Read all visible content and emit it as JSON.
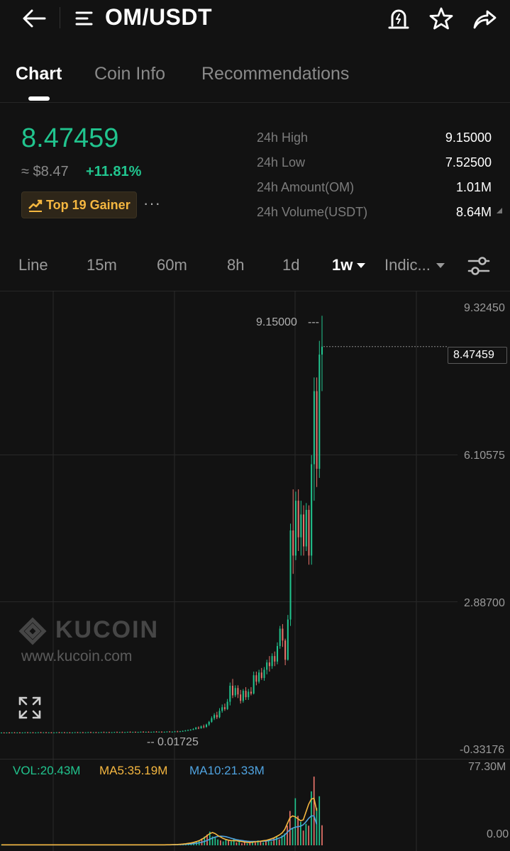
{
  "header": {
    "title": "OM/USDT"
  },
  "tabs": [
    {
      "label": "Chart",
      "active": true
    },
    {
      "label": "Coin Info",
      "active": false
    },
    {
      "label": "Recommendations",
      "active": false
    }
  ],
  "price": {
    "last": "8.47459",
    "usd": "≈ $8.47",
    "change": "+11.81%",
    "badge": "Top 19 Gainer",
    "more": "···"
  },
  "stats": [
    {
      "label": "24h High",
      "value": "9.15000"
    },
    {
      "label": "24h Low",
      "value": "7.52500"
    },
    {
      "label": "24h Amount(OM)",
      "value": "1.01M"
    },
    {
      "label": "24h Volume(USDT)",
      "value": "8.64M"
    }
  ],
  "intervals": [
    {
      "label": "Line",
      "active": false
    },
    {
      "label": "15m",
      "active": false
    },
    {
      "label": "60m",
      "active": false
    },
    {
      "label": "8h",
      "active": false
    },
    {
      "label": "1d",
      "active": false
    },
    {
      "label": "1w",
      "active": true
    },
    {
      "label": "Indic...",
      "active": false
    }
  ],
  "chart": {
    "watermark_brand": "KUCOIN",
    "watermark_url": "www.kucoin.com",
    "y_ticks": [
      "9.32450",
      "6.10575",
      "2.88700",
      "-0.33176"
    ],
    "max_label": "9.15000",
    "min_label": "0.01725",
    "current_price_label": "8.47459",
    "volume_ticks": [
      "77.30M",
      "0.00"
    ],
    "vol_legend": "VOL:20.43M",
    "ma5_legend": "MA5:35.19M",
    "ma10_legend": "MA10:21.33M"
  },
  "colors": {
    "up": "#21c48e",
    "down": "#e8736b",
    "ma5": "#f5b740",
    "ma10": "#4fa3e0",
    "background": "#121212"
  },
  "chart_data": {
    "type": "candlestick",
    "interval": "1w",
    "y_axis_range": [
      -0.33176,
      9.3245
    ],
    "y_ticks": [
      9.3245,
      6.10575,
      2.887,
      -0.33176
    ],
    "highest": 9.15,
    "lowest": 0.01725,
    "last_price": 8.47459,
    "candles": [
      {
        "open": 0.02,
        "high": 0.03,
        "low": 0.015,
        "close": 0.025
      },
      {
        "open": 0.025,
        "high": 0.03,
        "low": 0.015,
        "close": 0.02
      },
      {
        "open": 0.02,
        "high": 0.03,
        "low": 0.015,
        "close": 0.025
      },
      {
        "open": 0.025,
        "high": 0.035,
        "low": 0.018,
        "close": 0.02
      },
      {
        "open": 0.02,
        "high": 0.03,
        "low": 0.015,
        "close": 0.028
      },
      {
        "open": 0.028,
        "high": 0.035,
        "low": 0.02,
        "close": 0.022
      },
      {
        "open": 0.022,
        "high": 0.03,
        "low": 0.017,
        "close": 0.027
      },
      {
        "open": 0.027,
        "high": 0.035,
        "low": 0.02,
        "close": 0.021
      },
      {
        "open": 0.021,
        "high": 0.03,
        "low": 0.017,
        "close": 0.026
      },
      {
        "open": 0.026,
        "high": 0.035,
        "low": 0.02,
        "close": 0.03
      },
      {
        "open": 0.03,
        "high": 0.038,
        "low": 0.022,
        "close": 0.024
      },
      {
        "open": 0.024,
        "high": 0.032,
        "low": 0.018,
        "close": 0.029
      },
      {
        "open": 0.029,
        "high": 0.036,
        "low": 0.02,
        "close": 0.022
      },
      {
        "open": 0.022,
        "high": 0.03,
        "low": 0.017,
        "close": 0.027
      },
      {
        "open": 0.027,
        "high": 0.035,
        "low": 0.02,
        "close": 0.031
      },
      {
        "open": 0.031,
        "high": 0.04,
        "low": 0.024,
        "close": 0.025
      },
      {
        "open": 0.025,
        "high": 0.033,
        "low": 0.019,
        "close": 0.03
      },
      {
        "open": 0.03,
        "high": 0.038,
        "low": 0.022,
        "close": 0.024
      },
      {
        "open": 0.024,
        "high": 0.032,
        "low": 0.018,
        "close": 0.028
      },
      {
        "open": 0.028,
        "high": 0.036,
        "low": 0.021,
        "close": 0.022
      },
      {
        "open": 0.022,
        "high": 0.03,
        "low": 0.017,
        "close": 0.027
      },
      {
        "open": 0.027,
        "high": 0.035,
        "low": 0.02,
        "close": 0.031
      },
      {
        "open": 0.031,
        "high": 0.04,
        "low": 0.024,
        "close": 0.026
      },
      {
        "open": 0.026,
        "high": 0.034,
        "low": 0.019,
        "close": 0.03
      },
      {
        "open": 0.03,
        "high": 0.038,
        "low": 0.022,
        "close": 0.024
      },
      {
        "open": 0.024,
        "high": 0.032,
        "low": 0.018,
        "close": 0.029
      },
      {
        "open": 0.029,
        "high": 0.036,
        "low": 0.021,
        "close": 0.023
      },
      {
        "open": 0.023,
        "high": 0.031,
        "low": 0.017,
        "close": 0.028
      },
      {
        "open": 0.028,
        "high": 0.036,
        "low": 0.021,
        "close": 0.032
      },
      {
        "open": 0.032,
        "high": 0.04,
        "low": 0.024,
        "close": 0.026
      },
      {
        "open": 0.026,
        "high": 0.034,
        "low": 0.019,
        "close": 0.031
      },
      {
        "open": 0.031,
        "high": 0.039,
        "low": 0.023,
        "close": 0.025
      },
      {
        "open": 0.025,
        "high": 0.033,
        "low": 0.018,
        "close": 0.03
      },
      {
        "open": 0.03,
        "high": 0.038,
        "low": 0.022,
        "close": 0.034
      },
      {
        "open": 0.034,
        "high": 0.042,
        "low": 0.025,
        "close": 0.027
      },
      {
        "open": 0.027,
        "high": 0.035,
        "low": 0.02,
        "close": 0.032
      },
      {
        "open": 0.032,
        "high": 0.04,
        "low": 0.024,
        "close": 0.026
      },
      {
        "open": 0.026,
        "high": 0.034,
        "low": 0.019,
        "close": 0.031
      },
      {
        "open": 0.031,
        "high": 0.039,
        "low": 0.023,
        "close": 0.035
      },
      {
        "open": 0.035,
        "high": 0.045,
        "low": 0.026,
        "close": 0.029
      },
      {
        "open": 0.029,
        "high": 0.037,
        "low": 0.021,
        "close": 0.034
      },
      {
        "open": 0.034,
        "high": 0.042,
        "low": 0.025,
        "close": 0.028
      },
      {
        "open": 0.028,
        "high": 0.036,
        "low": 0.02,
        "close": 0.033
      },
      {
        "open": 0.033,
        "high": 0.041,
        "low": 0.024,
        "close": 0.037
      },
      {
        "open": 0.037,
        "high": 0.046,
        "low": 0.028,
        "close": 0.031
      },
      {
        "open": 0.031,
        "high": 0.039,
        "low": 0.023,
        "close": 0.036
      },
      {
        "open": 0.036,
        "high": 0.045,
        "low": 0.027,
        "close": 0.03
      },
      {
        "open": 0.03,
        "high": 0.038,
        "low": 0.022,
        "close": 0.035
      },
      {
        "open": 0.035,
        "high": 0.044,
        "low": 0.026,
        "close": 0.04
      },
      {
        "open": 0.04,
        "high": 0.05,
        "low": 0.03,
        "close": 0.034
      },
      {
        "open": 0.034,
        "high": 0.043,
        "low": 0.025,
        "close": 0.039
      },
      {
        "open": 0.039,
        "high": 0.048,
        "low": 0.029,
        "close": 0.033
      },
      {
        "open": 0.033,
        "high": 0.042,
        "low": 0.024,
        "close": 0.038
      },
      {
        "open": 0.038,
        "high": 0.047,
        "low": 0.028,
        "close": 0.043
      },
      {
        "open": 0.043,
        "high": 0.053,
        "low": 0.032,
        "close": 0.036
      },
      {
        "open": 0.036,
        "high": 0.046,
        "low": 0.027,
        "close": 0.041
      },
      {
        "open": 0.041,
        "high": 0.05,
        "low": 0.03,
        "close": 0.035
      },
      {
        "open": 0.035,
        "high": 0.045,
        "low": 0.026,
        "close": 0.04
      },
      {
        "open": 0.04,
        "high": 0.05,
        "low": 0.03,
        "close": 0.045
      },
      {
        "open": 0.045,
        "high": 0.056,
        "low": 0.034,
        "close": 0.038
      },
      {
        "open": 0.038,
        "high": 0.048,
        "low": 0.028,
        "close": 0.043
      },
      {
        "open": 0.043,
        "high": 0.053,
        "low": 0.032,
        "close": 0.037
      },
      {
        "open": 0.037,
        "high": 0.047,
        "low": 0.027,
        "close": 0.042
      },
      {
        "open": 0.042,
        "high": 0.052,
        "low": 0.031,
        "close": 0.047
      },
      {
        "open": 0.047,
        "high": 0.058,
        "low": 0.035,
        "close": 0.04
      },
      {
        "open": 0.04,
        "high": 0.05,
        "low": 0.03,
        "close": 0.045
      },
      {
        "open": 0.045,
        "high": 0.06,
        "low": 0.035,
        "close": 0.05
      },
      {
        "open": 0.05,
        "high": 0.065,
        "low": 0.04,
        "close": 0.045
      },
      {
        "open": 0.045,
        "high": 0.06,
        "low": 0.035,
        "close": 0.055
      },
      {
        "open": 0.055,
        "high": 0.07,
        "low": 0.045,
        "close": 0.06
      },
      {
        "open": 0.06,
        "high": 0.08,
        "low": 0.05,
        "close": 0.07
      },
      {
        "open": 0.07,
        "high": 0.09,
        "low": 0.06,
        "close": 0.08
      },
      {
        "open": 0.08,
        "high": 0.1,
        "low": 0.065,
        "close": 0.09
      },
      {
        "open": 0.09,
        "high": 0.12,
        "low": 0.08,
        "close": 0.1
      },
      {
        "open": 0.1,
        "high": 0.15,
        "low": 0.09,
        "close": 0.13
      },
      {
        "open": 0.13,
        "high": 0.16,
        "low": 0.1,
        "close": 0.12
      },
      {
        "open": 0.12,
        "high": 0.18,
        "low": 0.11,
        "close": 0.16
      },
      {
        "open": 0.16,
        "high": 0.2,
        "low": 0.12,
        "close": 0.15
      },
      {
        "open": 0.15,
        "high": 0.22,
        "low": 0.13,
        "close": 0.2
      },
      {
        "open": 0.2,
        "high": 0.28,
        "low": 0.17,
        "close": 0.26
      },
      {
        "open": 0.26,
        "high": 0.38,
        "low": 0.24,
        "close": 0.34
      },
      {
        "open": 0.34,
        "high": 0.45,
        "low": 0.3,
        "close": 0.41
      },
      {
        "open": 0.41,
        "high": 0.48,
        "low": 0.32,
        "close": 0.36
      },
      {
        "open": 0.36,
        "high": 0.56,
        "low": 0.34,
        "close": 0.5
      },
      {
        "open": 0.5,
        "high": 0.64,
        "low": 0.46,
        "close": 0.58
      },
      {
        "open": 0.58,
        "high": 0.66,
        "low": 0.5,
        "close": 0.54
      },
      {
        "open": 0.54,
        "high": 0.76,
        "low": 0.52,
        "close": 0.7
      },
      {
        "open": 0.7,
        "high": 1.12,
        "low": 0.62,
        "close": 1.05
      },
      {
        "open": 1.05,
        "high": 1.2,
        "low": 0.78,
        "close": 0.84
      },
      {
        "open": 0.84,
        "high": 1.06,
        "low": 0.8,
        "close": 1.0
      },
      {
        "open": 1.0,
        "high": 1.06,
        "low": 0.78,
        "close": 0.86
      },
      {
        "open": 0.86,
        "high": 0.96,
        "low": 0.66,
        "close": 0.72
      },
      {
        "open": 0.72,
        "high": 0.98,
        "low": 0.68,
        "close": 0.94
      },
      {
        "open": 0.94,
        "high": 1.02,
        "low": 0.74,
        "close": 0.8
      },
      {
        "open": 0.8,
        "high": 0.98,
        "low": 0.74,
        "close": 0.92
      },
      {
        "open": 0.92,
        "high": 1.02,
        "low": 0.84,
        "close": 0.88
      },
      {
        "open": 0.88,
        "high": 1.36,
        "low": 0.86,
        "close": 1.28
      },
      {
        "open": 1.28,
        "high": 1.36,
        "low": 1.06,
        "close": 1.14
      },
      {
        "open": 1.14,
        "high": 1.4,
        "low": 1.1,
        "close": 1.34
      },
      {
        "open": 1.34,
        "high": 1.44,
        "low": 1.18,
        "close": 1.22
      },
      {
        "open": 1.22,
        "high": 1.46,
        "low": 1.16,
        "close": 1.4
      },
      {
        "open": 1.4,
        "high": 1.62,
        "low": 1.3,
        "close": 1.56
      },
      {
        "open": 1.56,
        "high": 1.7,
        "low": 1.36,
        "close": 1.48
      },
      {
        "open": 1.48,
        "high": 1.76,
        "low": 1.42,
        "close": 1.7
      },
      {
        "open": 1.7,
        "high": 1.8,
        "low": 1.48,
        "close": 1.58
      },
      {
        "open": 1.58,
        "high": 2.0,
        "low": 1.52,
        "close": 1.92
      },
      {
        "open": 1.92,
        "high": 2.36,
        "low": 1.86,
        "close": 2.3
      },
      {
        "open": 2.3,
        "high": 2.4,
        "low": 1.9,
        "close": 2.04
      },
      {
        "open": 2.04,
        "high": 2.08,
        "low": 1.5,
        "close": 1.62
      },
      {
        "open": 1.62,
        "high": 2.6,
        "low": 1.6,
        "close": 2.5
      },
      {
        "open": 2.5,
        "high": 4.6,
        "low": 2.36,
        "close": 4.45
      },
      {
        "open": 4.45,
        "high": 5.35,
        "low": 3.5,
        "close": 3.9
      },
      {
        "open": 3.9,
        "high": 5.3,
        "low": 3.8,
        "close": 5.1
      },
      {
        "open": 5.1,
        "high": 5.35,
        "low": 4.0,
        "close": 4.3
      },
      {
        "open": 4.3,
        "high": 5.1,
        "low": 3.9,
        "close": 4.8
      },
      {
        "open": 4.8,
        "high": 5.0,
        "low": 3.9,
        "close": 4.1
      },
      {
        "open": 4.1,
        "high": 5.05,
        "low": 4.0,
        "close": 4.9
      },
      {
        "open": 4.9,
        "high": 5.0,
        "low": 3.7,
        "close": 3.9
      },
      {
        "open": 3.9,
        "high": 6.1,
        "low": 3.7,
        "close": 5.9
      },
      {
        "open": 5.9,
        "high": 7.8,
        "low": 5.1,
        "close": 7.5
      },
      {
        "open": 7.5,
        "high": 7.8,
        "low": 5.4,
        "close": 5.8
      },
      {
        "open": 5.8,
        "high": 8.6,
        "low": 5.6,
        "close": 8.3
      },
      {
        "open": 8.3,
        "high": 9.15,
        "low": 7.5,
        "close": 8.47459
      }
    ],
    "volume": {
      "range": [
        0,
        77.3
      ],
      "unit": "M",
      "vol_last": 20.43,
      "ma5_last": 35.19,
      "ma10_last": 21.33,
      "bars": [
        0.5,
        0.4,
        0.6,
        0.5,
        0.4,
        0.5,
        0.6,
        0.4,
        0.5,
        0.6,
        0.5,
        0.4,
        0.5,
        0.6,
        0.5,
        0.4,
        0.6,
        0.5,
        0.4,
        0.5,
        0.6,
        0.5,
        0.4,
        0.5,
        0.6,
        0.5,
        0.4,
        0.5,
        0.6,
        0.5,
        0.4,
        0.6,
        0.5,
        0.4,
        0.5,
        0.6,
        0.5,
        0.4,
        0.5,
        0.6,
        0.5,
        0.4,
        0.5,
        0.6,
        0.5,
        0.4,
        0.6,
        0.5,
        0.4,
        0.5,
        0.6,
        0.5,
        0.4,
        0.5,
        0.6,
        0.5,
        0.4,
        0.5,
        0.6,
        0.5,
        0.4,
        0.5,
        0.6,
        0.7,
        0.8,
        0.9,
        1.0,
        1.2,
        1.5,
        1.8,
        2.0,
        2.5,
        3.0,
        4.0,
        5.0,
        7.0,
        9.0,
        11.0,
        14.0,
        9.0,
        8.0,
        6.0,
        5.0,
        4.0,
        6.0,
        5.0,
        4.0,
        7.0,
        3.0,
        4.0,
        2.0,
        3.0,
        2.0,
        3.0,
        4.0,
        3.0,
        5.0,
        4.0,
        3.0,
        5.0,
        6.0,
        4.0,
        7.0,
        9.0,
        6.0,
        10.0,
        12.0,
        20.0,
        35.0,
        18.0,
        48.0,
        30.0,
        24.0,
        15.0,
        22.0,
        20.0,
        55.0,
        70.0,
        38.0,
        50.0,
        20.43
      ],
      "ma5": [
        0.5,
        0.5,
        0.5,
        0.5,
        0.5,
        0.5,
        0.5,
        0.5,
        0.5,
        0.5,
        0.5,
        0.5,
        0.5,
        0.5,
        0.5,
        0.5,
        0.5,
        0.5,
        0.5,
        0.5,
        0.5,
        0.5,
        0.5,
        0.5,
        0.5,
        0.5,
        0.5,
        0.5,
        0.5,
        0.5,
        0.5,
        0.5,
        0.5,
        0.5,
        0.5,
        0.5,
        0.5,
        0.5,
        0.5,
        0.5,
        0.5,
        0.5,
        0.5,
        0.5,
        0.5,
        0.5,
        0.5,
        0.5,
        0.5,
        0.5,
        0.5,
        0.5,
        0.5,
        0.5,
        0.5,
        0.5,
        0.5,
        0.5,
        0.5,
        0.5,
        0.5,
        0.5,
        0.6,
        0.6,
        0.7,
        0.8,
        0.9,
        1.1,
        1.3,
        1.6,
        2.0,
        2.4,
        3.0,
        3.8,
        4.8,
        6.2,
        7.8,
        10.0,
        12.0,
        13.0,
        12.0,
        10.0,
        8.5,
        7.0,
        6.0,
        5.2,
        4.8,
        4.8,
        4.6,
        4.2,
        3.8,
        3.4,
        3.0,
        3.0,
        3.2,
        3.6,
        3.8,
        4.2,
        4.6,
        5.0,
        5.8,
        6.6,
        7.6,
        9.0,
        10.5,
        12.5,
        16.0,
        22.0,
        28.0,
        30.0,
        29.0,
        27.0,
        25.0,
        26.0,
        34.0,
        42.0,
        47.0,
        48.0,
        35.19
      ],
      "ma10": [
        0.5,
        0.5,
        0.5,
        0.5,
        0.5,
        0.5,
        0.5,
        0.5,
        0.5,
        0.5,
        0.5,
        0.5,
        0.5,
        0.5,
        0.5,
        0.5,
        0.5,
        0.5,
        0.5,
        0.5,
        0.5,
        0.5,
        0.5,
        0.5,
        0.5,
        0.5,
        0.5,
        0.5,
        0.5,
        0.5,
        0.5,
        0.5,
        0.5,
        0.5,
        0.5,
        0.5,
        0.5,
        0.5,
        0.5,
        0.5,
        0.5,
        0.5,
        0.5,
        0.5,
        0.5,
        0.5,
        0.5,
        0.5,
        0.5,
        0.5,
        0.5,
        0.5,
        0.5,
        0.5,
        0.5,
        0.5,
        0.5,
        0.5,
        0.5,
        0.5,
        0.5,
        0.5,
        0.5,
        0.5,
        0.6,
        0.6,
        0.7,
        0.8,
        0.9,
        1.0,
        1.2,
        1.4,
        1.7,
        2.1,
        2.6,
        3.2,
        4.0,
        5.0,
        6.2,
        7.4,
        8.4,
        9.0,
        9.3,
        9.2,
        8.8,
        8.0,
        7.2,
        6.5,
        5.8,
        5.3,
        4.9,
        4.5,
        4.2,
        4.0,
        3.9,
        3.9,
        4.0,
        4.1,
        4.2,
        4.4,
        4.8,
        5.2,
        5.6,
        6.4,
        7.4,
        8.5,
        10.5,
        13.2,
        16.0,
        17.5,
        18.5,
        19.0,
        19.5,
        21.0,
        24.0,
        27.5,
        30.0,
        30.0,
        21.33
      ]
    }
  }
}
